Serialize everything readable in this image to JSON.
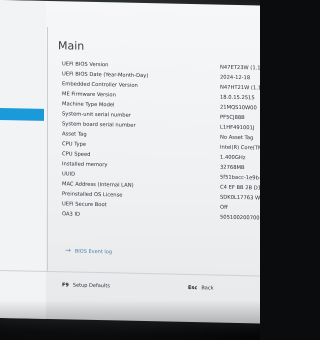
{
  "page": {
    "title": "Main"
  },
  "rows": [
    {
      "label": "UEFI BIOS Version",
      "value": "N47ET23W (1.12"
    },
    {
      "label": "UEFI BIOS Date (Year-Month-Day)",
      "value": "2024-12-18"
    },
    {
      "label": "Embedded Controller Version",
      "value": "N47HT21W (1.11"
    },
    {
      "label": "ME Firmware Version",
      "value": "18.0.15.2515"
    },
    {
      "label": "Machine Type Model",
      "value": "21MQS10W00"
    },
    {
      "label": "System-unit serial number",
      "value": "PF5CJ88B"
    },
    {
      "label": "System board serial number",
      "value": "L1HF491001J"
    },
    {
      "label": "Asset Tag",
      "value": "No Asset Tag"
    },
    {
      "label": "CPU Type",
      "value": "Intel(R) Core(TM) U"
    },
    {
      "label": "CPU Speed",
      "value": "1.400GHz"
    },
    {
      "label": "Installed memory",
      "value": "32768MB"
    },
    {
      "label": "UUID",
      "value": "5f51bacc-1e9b-11b"
    },
    {
      "label": "MAC Address (Internal LAN)",
      "value": "C4 EF BB 2B D1 AF"
    },
    {
      "label": "Preinstalled OS License",
      "value": "SDK0L17763 WIN"
    },
    {
      "label": "UEFI Secure Boot",
      "value": "Off"
    },
    {
      "label": "OA3 ID",
      "value": "5051002007005"
    }
  ],
  "bios_log": {
    "label": "BIOS Event log",
    "icon": "arrow-icon"
  },
  "footer": {
    "setup_defaults": {
      "key": "F9",
      "label": "Setup Defaults"
    },
    "back": {
      "key": "Esc",
      "label": "Back"
    }
  }
}
